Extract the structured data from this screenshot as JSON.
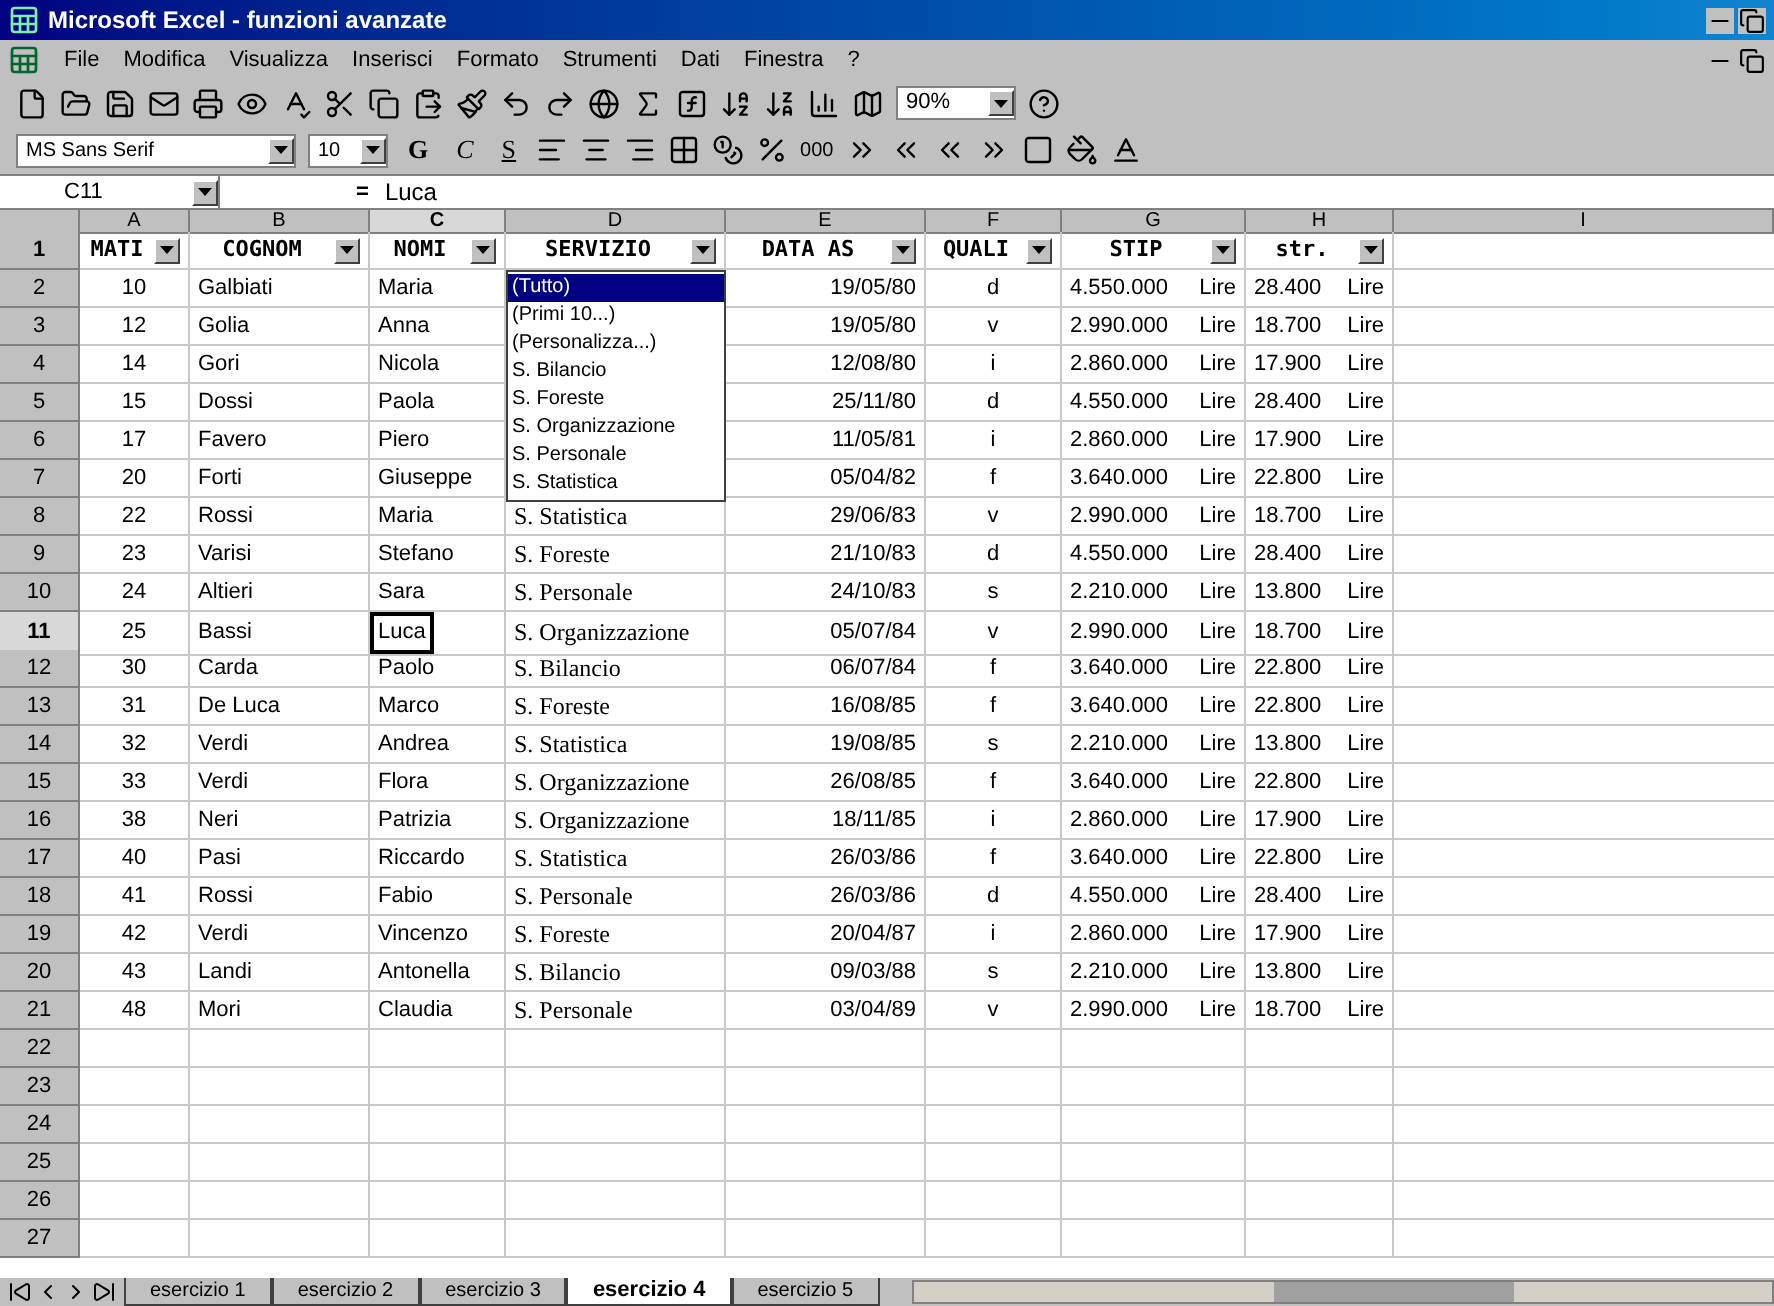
{
  "window": {
    "title": "Microsoft Excel - funzioni avanzate"
  },
  "menu": [
    "File",
    "Modifica",
    "Visualizza",
    "Inserisci",
    "Formato",
    "Strumenti",
    "Dati",
    "Finestra",
    "?"
  ],
  "toolbar": {
    "zoom": "90%"
  },
  "format_toolbar": {
    "font": "MS Sans Serif",
    "size": "10",
    "bold": "G",
    "italic": "C",
    "underline": "S",
    "thousands": "000"
  },
  "formula_bar": {
    "name_box": "C11",
    "equals": "=",
    "value": "Luca"
  },
  "columns": [
    {
      "letter": "A",
      "selected": false
    },
    {
      "letter": "B",
      "selected": false
    },
    {
      "letter": "C",
      "selected": true
    },
    {
      "letter": "D",
      "selected": false
    },
    {
      "letter": "E",
      "selected": false
    },
    {
      "letter": "F",
      "selected": false
    },
    {
      "letter": "G",
      "selected": false
    },
    {
      "letter": "H",
      "selected": false
    },
    {
      "letter": "I",
      "selected": false
    }
  ],
  "header_row": {
    "number": "1",
    "cells": [
      "MATI",
      "COGNOM",
      "NOMI",
      "SERVIZIO",
      "DATA AS",
      "QUALI",
      "STIP",
      "str."
    ]
  },
  "rows": [
    {
      "number": "2",
      "selected": false,
      "mati": "10",
      "cognome": "Galbiati",
      "nome": "Maria",
      "data": "19/05/80",
      "quali": "d",
      "stip": "4.550.000",
      "stip_unit": "Lire",
      "str": "28.400",
      "str_unit": "Lire"
    },
    {
      "number": "3",
      "selected": false,
      "mati": "12",
      "cognome": "Golia",
      "nome": "Anna",
      "data": "19/05/80",
      "quali": "v",
      "stip": "2.990.000",
      "stip_unit": "Lire",
      "str": "18.700",
      "str_unit": "Lire"
    },
    {
      "number": "4",
      "selected": false,
      "mati": "14",
      "cognome": "Gori",
      "nome": "Nicola",
      "data": "12/08/80",
      "quali": "i",
      "stip": "2.860.000",
      "stip_unit": "Lire",
      "str": "17.900",
      "str_unit": "Lire"
    },
    {
      "number": "5",
      "selected": false,
      "mati": "15",
      "cognome": "Dossi",
      "nome": "Paola",
      "data": "25/11/80",
      "quali": "d",
      "stip": "4.550.000",
      "stip_unit": "Lire",
      "str": "28.400",
      "str_unit": "Lire"
    },
    {
      "number": "6",
      "selected": false,
      "mati": "17",
      "cognome": "Favero",
      "nome": "Piero",
      "data": "11/05/81",
      "quali": "i",
      "stip": "2.860.000",
      "stip_unit": "Lire",
      "str": "17.900",
      "str_unit": "Lire"
    },
    {
      "number": "7",
      "selected": false,
      "mati": "20",
      "cognome": "Forti",
      "nome": "Giuseppe",
      "data": "05/04/82",
      "quali": "f",
      "stip": "3.640.000",
      "stip_unit": "Lire",
      "str": "22.800",
      "str_unit": "Lire"
    },
    {
      "number": "8",
      "selected": false,
      "mati": "22",
      "cognome": "Rossi",
      "nome": "Maria",
      "servizio": "S. Statistica",
      "data": "29/06/83",
      "quali": "v",
      "stip": "2.990.000",
      "stip_unit": "Lire",
      "str": "18.700",
      "str_unit": "Lire"
    },
    {
      "number": "9",
      "selected": false,
      "mati": "23",
      "cognome": "Varisi",
      "nome": "Stefano",
      "servizio": "S. Foreste",
      "data": "21/10/83",
      "quali": "d",
      "stip": "4.550.000",
      "stip_unit": "Lire",
      "str": "28.400",
      "str_unit": "Lire"
    },
    {
      "number": "10",
      "selected": false,
      "mati": "24",
      "cognome": "Altieri",
      "nome": "Sara",
      "servizio": "S. Personale",
      "data": "24/10/83",
      "quali": "s",
      "stip": "2.210.000",
      "stip_unit": "Lire",
      "str": "13.800",
      "str_unit": "Lire"
    },
    {
      "number": "11",
      "selected": true,
      "mati": "25",
      "cognome": "Bassi",
      "nome": "Luca",
      "servizio": "S. Organizzazione",
      "data": "05/07/84",
      "quali": "v",
      "stip": "2.990.000",
      "stip_unit": "Lire",
      "str": "18.700",
      "str_unit": "Lire"
    },
    {
      "number": "12",
      "selected": false,
      "mati": "30",
      "cognome": "Carda",
      "nome": "Paolo",
      "servizio": "S. Bilancio",
      "data": "06/07/84",
      "quali": "f",
      "stip": "3.640.000",
      "stip_unit": "Lire",
      "str": "22.800",
      "str_unit": "Lire"
    },
    {
      "number": "13",
      "selected": false,
      "mati": "31",
      "cognome": "De Luca",
      "nome": "Marco",
      "servizio": "S. Foreste",
      "data": "16/08/85",
      "quali": "f",
      "stip": "3.640.000",
      "stip_unit": "Lire",
      "str": "22.800",
      "str_unit": "Lire"
    },
    {
      "number": "14",
      "selected": false,
      "mati": "32",
      "cognome": "Verdi",
      "nome": "Andrea",
      "servizio": "S. Statistica",
      "data": "19/08/85",
      "quali": "s",
      "stip": "2.210.000",
      "stip_unit": "Lire",
      "str": "13.800",
      "str_unit": "Lire"
    },
    {
      "number": "15",
      "selected": false,
      "mati": "33",
      "cognome": "Verdi",
      "nome": "Flora",
      "servizio": "S. Organizzazione",
      "data": "26/08/85",
      "quali": "f",
      "stip": "3.640.000",
      "stip_unit": "Lire",
      "str": "22.800",
      "str_unit": "Lire"
    },
    {
      "number": "16",
      "selected": false,
      "mati": "38",
      "cognome": "Neri",
      "nome": "Patrizia",
      "servizio": "S. Organizzazione",
      "data": "18/11/85",
      "quali": "i",
      "stip": "2.860.000",
      "stip_unit": "Lire",
      "str": "17.900",
      "str_unit": "Lire"
    },
    {
      "number": "17",
      "selected": false,
      "mati": "40",
      "cognome": "Pasi",
      "nome": "Riccardo",
      "servizio": "S. Statistica",
      "data": "26/03/86",
      "quali": "f",
      "stip": "3.640.000",
      "stip_unit": "Lire",
      "str": "22.800",
      "str_unit": "Lire"
    },
    {
      "number": "18",
      "selected": false,
      "mati": "41",
      "cognome": "Rossi",
      "nome": "Fabio",
      "servizio": "S. Personale",
      "data": "26/03/86",
      "quali": "d",
      "stip": "4.550.000",
      "stip_unit": "Lire",
      "str": "28.400",
      "str_unit": "Lire"
    },
    {
      "number": "19",
      "selected": false,
      "mati": "42",
      "cognome": "Verdi",
      "nome": "Vincenzo",
      "servizio": "S. Foreste",
      "data": "20/04/87",
      "quali": "i",
      "stip": "2.860.000",
      "stip_unit": "Lire",
      "str": "17.900",
      "str_unit": "Lire"
    },
    {
      "number": "20",
      "selected": false,
      "mati": "43",
      "cognome": "Landi",
      "nome": "Antonella",
      "servizio": "S. Bilancio",
      "data": "09/03/88",
      "quali": "s",
      "stip": "2.210.000",
      "stip_unit": "Lire",
      "str": "13.800",
      "str_unit": "Lire"
    },
    {
      "number": "21",
      "selected": false,
      "mati": "48",
      "cognome": "Mori",
      "nome": "Claudia",
      "servizio": "S. Personale",
      "data": "03/04/89",
      "quali": "v",
      "stip": "2.990.000",
      "stip_unit": "Lire",
      "str": "18.700",
      "str_unit": "Lire"
    }
  ],
  "empty_rows": [
    "22",
    "23",
    "24",
    "25",
    "26",
    "27"
  ],
  "autofilter_menu": {
    "items": [
      {
        "label": "(Tutto)",
        "selected": true
      },
      {
        "label": "(Primi 10...)",
        "selected": false
      },
      {
        "label": "(Personalizza...)",
        "selected": false
      },
      {
        "label": "S. Bilancio",
        "selected": false
      },
      {
        "label": "S. Foreste",
        "selected": false
      },
      {
        "label": "S. Organizzazione",
        "selected": false
      },
      {
        "label": "S. Personale",
        "selected": false
      },
      {
        "label": "S. Statistica",
        "selected": false
      }
    ]
  },
  "sheet_tabs": [
    {
      "label": "esercizio 1",
      "selected": false
    },
    {
      "label": "esercizio 2",
      "selected": false
    },
    {
      "label": "esercizio 3",
      "selected": false
    },
    {
      "label": "esercizio 4",
      "selected": true
    },
    {
      "label": "esercizio 5",
      "selected": false
    }
  ]
}
